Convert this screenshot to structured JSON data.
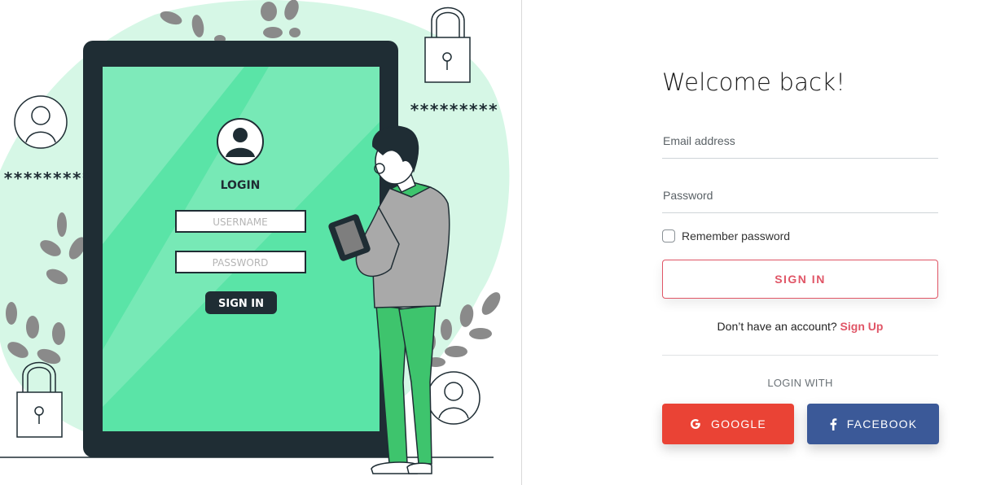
{
  "illustration": {
    "login_heading": "LOGIN",
    "username_placeholder": "USERNAME",
    "password_placeholder": "PASSWORD",
    "signin_label": "SIGN IN",
    "mask_left": "*********",
    "mask_right": "*********",
    "colors": {
      "accent_green": "#5ae4a7",
      "light_green": "#d6f7e6",
      "dark": "#1f2d34",
      "leaf_gray": "#8a8a8a"
    }
  },
  "form": {
    "title": "Welcome back!",
    "email_placeholder": "Email address",
    "password_placeholder": "Password",
    "remember_label": "Remember password",
    "signin_label": "SIGN IN",
    "signup_prompt": "Don’t have an account?",
    "signup_link": "Sign Up",
    "login_with": "LOGIN WITH",
    "google_label": "GOOGLE",
    "facebook_label": "FACEBOOK",
    "colors": {
      "accent": "#e05566",
      "google": "#ea4335",
      "facebook": "#3b5998"
    }
  }
}
